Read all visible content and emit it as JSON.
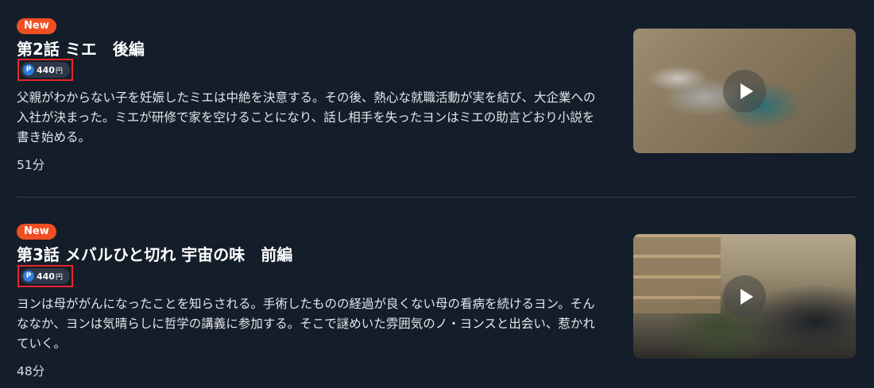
{
  "episodes": [
    {
      "badge": "New",
      "title": "第2話 ミエ　後編",
      "price": {
        "point_symbol": "P",
        "value": "440",
        "unit": "円"
      },
      "synopsis": "父親がわからない子を妊娠したミエは中絶を決意する。その後、熱心な就職活動が実を結び、大企業への入社が決まった。ミエが研修で家を空けることになり、話し相手を失ったヨンはミエの助言どおり小説を書き始める。",
      "duration": "51分",
      "thumbnail_icon": "play-icon"
    },
    {
      "badge": "New",
      "title": "第3話 メバルひと切れ 宇宙の味　前編",
      "price": {
        "point_symbol": "P",
        "value": "440",
        "unit": "円"
      },
      "synopsis": "ヨンは母ががんになったことを知らされる。手術したものの経過が良くない母の看病を続けるヨン。そんななか、ヨンは気晴らしに哲学の講義に参加する。そこで謎めいた雰囲気のノ・ヨンスと出会い、惹かれていく。",
      "duration": "48分",
      "thumbnail_icon": "play-icon"
    }
  ],
  "colors": {
    "background": "#141d2a",
    "new_badge": "#f04e23",
    "highlight_frame": "#e8262a",
    "point_icon": "#2f7de1"
  }
}
